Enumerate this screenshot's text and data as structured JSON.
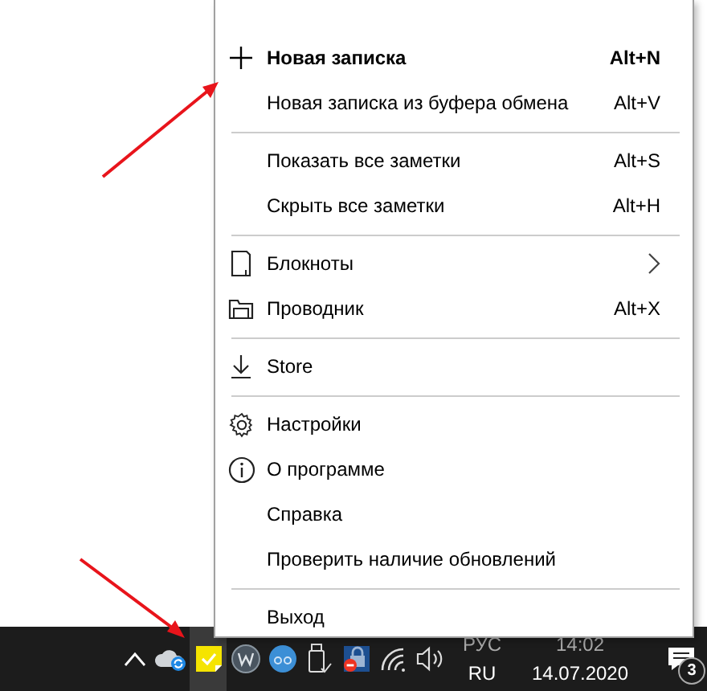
{
  "menu": {
    "items": [
      {
        "label": "Новая записка",
        "shortcut": "Alt+N",
        "emphasized": true,
        "separator_before": false,
        "submenu": false
      },
      {
        "label": "Новая записка из буфера обмена",
        "shortcut": "Alt+V",
        "emphasized": false,
        "separator_before": false,
        "submenu": false
      },
      {
        "label": "Показать все заметки",
        "shortcut": "Alt+S",
        "emphasized": false,
        "separator_before": true,
        "submenu": false
      },
      {
        "label": "Скрыть все заметки",
        "shortcut": "Alt+H",
        "emphasized": false,
        "separator_before": false,
        "submenu": false
      },
      {
        "label": "Блокноты",
        "emphasized": false,
        "separator_before": true,
        "submenu": true
      },
      {
        "label": "Проводник",
        "shortcut": "Alt+X",
        "emphasized": false,
        "separator_before": false,
        "submenu": false
      },
      {
        "label": "Store",
        "emphasized": false,
        "separator_before": true,
        "submenu": false
      },
      {
        "label": "Настройки",
        "emphasized": false,
        "separator_before": true,
        "submenu": false
      },
      {
        "label": "О программе",
        "emphasized": false,
        "separator_before": false,
        "submenu": false
      },
      {
        "label": "Справка",
        "emphasized": false,
        "separator_before": false,
        "submenu": false
      },
      {
        "label": "Проверить наличие обновлений",
        "emphasized": false,
        "separator_before": false,
        "submenu": false
      },
      {
        "label": "Выход",
        "emphasized": false,
        "separator_before": true,
        "submenu": false
      }
    ]
  },
  "taskbar": {
    "tray_icons": [
      {
        "selected": false
      },
      {
        "selected": true
      },
      {
        "selected": false
      },
      {
        "selected": false
      },
      {
        "selected": false
      },
      {
        "selected": false
      },
      {
        "selected": false
      },
      {
        "selected": false
      }
    ],
    "language": {
      "top": "РУС",
      "bottom": "RU"
    },
    "clock": {
      "time": "14:02",
      "date": "14.07.2020"
    },
    "notifications": {
      "count": "3"
    }
  }
}
